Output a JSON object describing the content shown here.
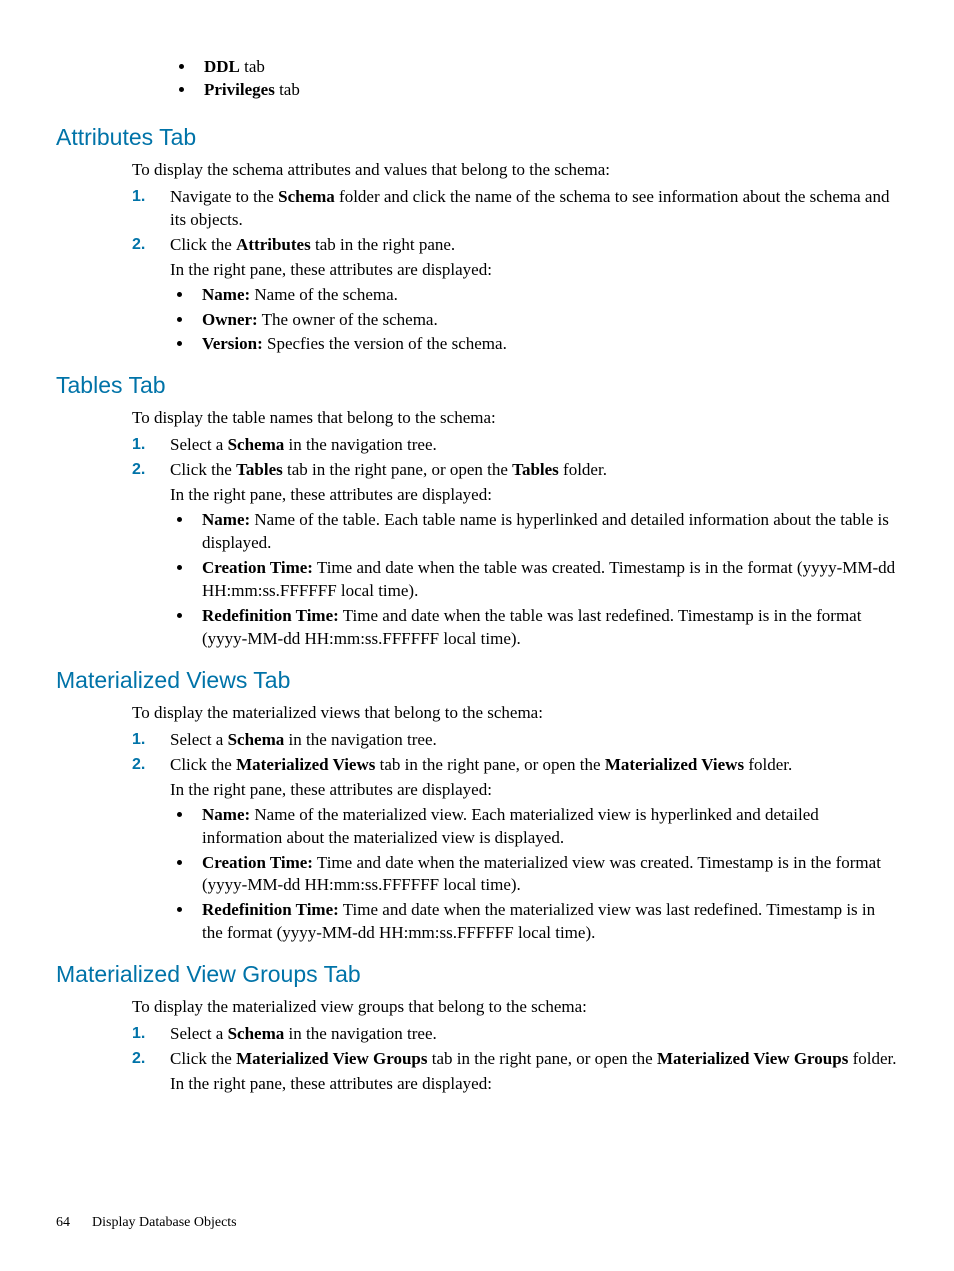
{
  "topBullets": {
    "b1_bold": "DDL",
    "b1_rest": " tab",
    "b2_bold": "Privileges",
    "b2_rest": " tab"
  },
  "sec1": {
    "heading": "Attributes Tab",
    "intro": "To display the schema attributes and values that belong to the schema:",
    "step1_a": "Navigate to the ",
    "step1_bold": "Schema",
    "step1_b": " folder and click the name of the schema to see information about the schema and its objects.",
    "step2_a": "Click the ",
    "step2_bold": "Attributes",
    "step2_b": " tab in the right pane.",
    "step2_para": "In the right pane, these attributes are displayed:",
    "bul1_bold": "Name:",
    "bul1_rest": " Name of the schema.",
    "bul2_bold": "Owner:",
    "bul2_rest": " The owner of the schema.",
    "bul3_bold": "Version:",
    "bul3_rest": " Specfies the version of the schema."
  },
  "sec2": {
    "heading": "Tables Tab",
    "intro": "To display the table names that belong to the schema:",
    "step1_a": "Select a ",
    "step1_bold": "Schema",
    "step1_b": " in the navigation tree.",
    "step2_a": "Click the ",
    "step2_bold1": "Tables",
    "step2_b": " tab in the right pane, or open the ",
    "step2_bold2": "Tables",
    "step2_c": " folder.",
    "step2_para": "In the right pane, these attributes are displayed:",
    "bul1_bold": "Name:",
    "bul1_rest": " Name of the table. Each table name is hyperlinked and detailed information about the table is displayed.",
    "bul2_bold": "Creation Time:",
    "bul2_rest": " Time and date when the table was created. Timestamp is in the format (yyyy-MM-dd HH:mm:ss.FFFFFF local time).",
    "bul3_bold": "Redefinition Time:",
    "bul3_rest": " Time and date when the table was last redefined. Timestamp is in the format (yyyy-MM-dd HH:mm:ss.FFFFFF local time)."
  },
  "sec3": {
    "heading": "Materialized Views Tab",
    "intro": "To display the materialized views that belong to the schema:",
    "step1_a": "Select a ",
    "step1_bold": "Schema",
    "step1_b": " in the navigation tree.",
    "step2_a": "Click the ",
    "step2_bold1": "Materialized Views",
    "step2_b": " tab in the right pane, or open the ",
    "step2_bold2": "Materialized Views",
    "step2_c": " folder.",
    "step2_para": "In the right pane, these attributes are displayed:",
    "bul1_bold": "Name:",
    "bul1_rest": " Name of the materialized view. Each materialized view is hyperlinked and detailed information about the materialized view is displayed.",
    "bul2_bold": "Creation Time:",
    "bul2_rest": " Time and date when the materialized view was created. Timestamp is in the format (yyyy-MM-dd HH:mm:ss.FFFFFF local time).",
    "bul3_bold": "Redefinition Time:",
    "bul3_rest": " Time and date when the materialized view was last redefined. Timestamp is in the format (yyyy-MM-dd HH:mm:ss.FFFFFF local time)."
  },
  "sec4": {
    "heading": "Materialized View Groups Tab",
    "intro": "To display the materialized view groups that belong to the schema:",
    "step1_a": "Select a ",
    "step1_bold": "Schema",
    "step1_b": " in the navigation tree.",
    "step2_a": "Click the ",
    "step2_bold1": "Materialized View Groups",
    "step2_b": " tab in the right pane, or open the ",
    "step2_bold2": "Materialized View Groups",
    "step2_c": " folder.",
    "step2_para": "In the right pane, these attributes are displayed:"
  },
  "footer": {
    "pageNum": "64",
    "pageTitle": "Display Database Objects"
  }
}
